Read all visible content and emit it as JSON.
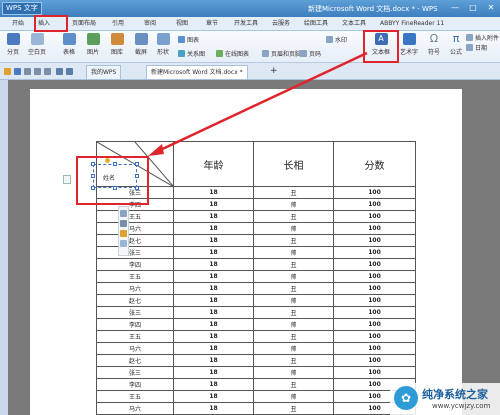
{
  "titlebar": {
    "app_name": "WPS 文字",
    "doc_title": "新建Microsoft Word 文档.docx * - WPS",
    "minimize": "—",
    "maximize": "□",
    "close": "✕"
  },
  "menu": {
    "tabs": [
      "开始",
      "插入",
      "页面布局",
      "引用",
      "审阅",
      "视图",
      "章节",
      "开发工具",
      "云服务",
      "绘图工具",
      "文本工具",
      "ABBYY FineReader 11"
    ],
    "active_tab": "插入"
  },
  "ribbon": {
    "buttons": [
      {
        "label": "分页",
        "icon": "page-break-icon",
        "color": "#4a7bc0"
      },
      {
        "label": "空白页",
        "icon": "blank-page-icon",
        "color": "#9ab6d6"
      },
      {
        "label": "表格",
        "icon": "table-icon",
        "color": "#5d8fcb"
      },
      {
        "label": "图片",
        "icon": "picture-icon",
        "color": "#5aa05a"
      },
      {
        "label": "图库",
        "icon": "gallery-icon",
        "color": "#d08a3a"
      },
      {
        "label": "截屏",
        "icon": "screenshot-icon",
        "color": "#6b8fc0"
      },
      {
        "label": "形状",
        "icon": "shape-icon",
        "color": "#7aa0d0"
      },
      {
        "label": "文本框",
        "icon": "textbox-icon",
        "color": "#3e6db3"
      },
      {
        "label": "艺术字",
        "icon": "wordart-icon",
        "color": "#3b76c4"
      },
      {
        "label": "符号",
        "icon": "omega-icon",
        "color": "#6a7f98"
      },
      {
        "label": "公式",
        "icon": "pi-icon",
        "color": "#3e6db3"
      }
    ],
    "small": {
      "chart": "图表",
      "relation": "关系图",
      "online_chart": "在线图表",
      "header_footer": "页眉和页脚",
      "page_number": "页码",
      "watermark": "水印",
      "attachment": "插入附件",
      "date": "日期"
    },
    "symbol_glyph": "Ω",
    "formula_glyph": "π",
    "textbox_glyph": "A"
  },
  "doc_tabs": [
    {
      "label": "我的WPS",
      "active": false
    },
    {
      "label": "新建Microsoft Word 文档.docx *",
      "active": true
    }
  ],
  "add_tab": "+",
  "table": {
    "headers": [
      "",
      "年龄",
      "长相",
      "分数"
    ],
    "corner_label": "姓名",
    "rows": [
      [
        "张三",
        "18",
        "丑",
        "100"
      ],
      [
        "李四",
        "18",
        "帅",
        "100"
      ],
      [
        "王五",
        "18",
        "丑",
        "100"
      ],
      [
        "马六",
        "18",
        "帅",
        "100"
      ],
      [
        "赵七",
        "18",
        "丑",
        "100"
      ],
      [
        "张三",
        "18",
        "帅",
        "100"
      ],
      [
        "李四",
        "18",
        "丑",
        "100"
      ],
      [
        "王五",
        "18",
        "帅",
        "100"
      ],
      [
        "马六",
        "18",
        "丑",
        "100"
      ],
      [
        "赵七",
        "18",
        "帅",
        "100"
      ],
      [
        "张三",
        "18",
        "丑",
        "100"
      ],
      [
        "李四",
        "18",
        "帅",
        "100"
      ],
      [
        "王五",
        "18",
        "丑",
        "100"
      ],
      [
        "马六",
        "18",
        "帅",
        "100"
      ],
      [
        "赵七",
        "18",
        "丑",
        "100"
      ],
      [
        "张三",
        "18",
        "帅",
        "100"
      ],
      [
        "李四",
        "18",
        "丑",
        "100"
      ],
      [
        "王五",
        "18",
        "帅",
        "100"
      ],
      [
        "马六",
        "18",
        "丑",
        "100"
      ],
      [
        "马六",
        "18",
        "帅",
        "100"
      ]
    ]
  },
  "watermark": {
    "title": "纯净系统之家",
    "url": "www.ycwjzy.com"
  },
  "colors": {
    "highlight": "#e0242b",
    "accent": "#3e7fbf"
  }
}
